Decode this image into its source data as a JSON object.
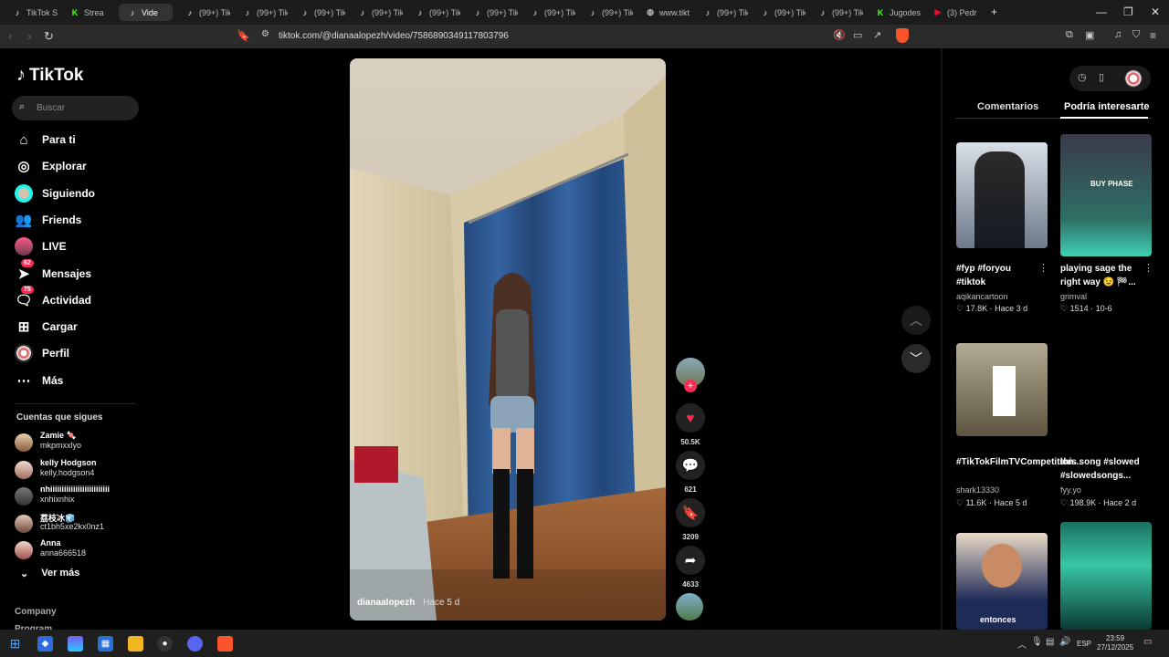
{
  "browser": {
    "tabs": [
      {
        "label": "TikTok S",
        "icon": "tiktok-icon"
      },
      {
        "label": "Strea",
        "icon": "kick-icon"
      },
      {
        "label": "Vide",
        "icon": "tiktok-icon",
        "active": true
      },
      {
        "label": "(99+) Tik",
        "icon": "tiktok-icon"
      },
      {
        "label": "(99+) Tik",
        "icon": "tiktok-icon"
      },
      {
        "label": "(99+) Tik",
        "icon": "tiktok-icon"
      },
      {
        "label": "(99+) Tik",
        "icon": "tiktok-icon"
      },
      {
        "label": "(99+) Tik",
        "icon": "tiktok-icon"
      },
      {
        "label": "(99+) Tik",
        "icon": "tiktok-icon"
      },
      {
        "label": "(99+) Tik",
        "icon": "tiktok-icon"
      },
      {
        "label": "(99+) Tik",
        "icon": "tiktok-icon"
      },
      {
        "label": "www.tikt",
        "icon": "globe-icon"
      },
      {
        "label": "(99+) Tik",
        "icon": "tiktok-icon"
      },
      {
        "label": "(99+) Tik",
        "icon": "tiktok-icon"
      },
      {
        "label": "(99+) Tik",
        "icon": "tiktok-icon"
      },
      {
        "label": "Jugodes",
        "icon": "kick-icon"
      },
      {
        "label": "(3) Pedr",
        "icon": "youtube-icon"
      }
    ],
    "new_tab": "+",
    "url": "tiktok.com/@dianaalopezh/video/7586890349117803796"
  },
  "tiktok": {
    "logo": "TikTok",
    "search_placeholder": "Buscar",
    "nav": [
      {
        "label": "Para ti",
        "icon": "home-icon"
      },
      {
        "label": "Explorar",
        "icon": "compass-icon"
      },
      {
        "label": "Siguiendo",
        "icon": "following-avatar-icon"
      },
      {
        "label": "Friends",
        "icon": "friends-icon"
      },
      {
        "label": "LIVE",
        "icon": "live-icon"
      },
      {
        "label": "Mensajes",
        "icon": "messages-icon",
        "badge": "62"
      },
      {
        "label": "Actividad",
        "icon": "activity-icon",
        "badge": "75"
      },
      {
        "label": "Cargar",
        "icon": "upload-icon"
      },
      {
        "label": "Perfil",
        "icon": "profile-icon"
      },
      {
        "label": "Más",
        "icon": "more-icon"
      }
    ],
    "following_title": "Cuentas que sigues",
    "following": [
      {
        "name": "Zamie 🍬",
        "handle": "mkpmxxlyo"
      },
      {
        "name": "kelly Hodgson",
        "handle": "kelly.hodgson4"
      },
      {
        "name": "nhiiiiiiiiiiiiiiiiiiiiiiiiii",
        "handle": "xnhixnhix"
      },
      {
        "name": "荔枝冰🧊",
        "handle": "ct1bh5xe2kx0nz1"
      },
      {
        "name": "Anna",
        "handle": "anna666518"
      }
    ],
    "see_more": "Ver más",
    "footer": [
      "Company",
      "Program"
    ]
  },
  "video": {
    "author": "dianaalopezh",
    "time": " · Hace 5 d",
    "likes": "50.5K",
    "comments": "621",
    "saves": "3209",
    "shares": "4633"
  },
  "right_panel": {
    "tabs": [
      "Comentarios",
      "Podría interesarte"
    ],
    "cards": [
      {
        "title": "#fyp #foryou #tiktok",
        "author": "aqikancartoon",
        "likes": "17.8K",
        "time": "Hace 3 d",
        "thumb_text": ""
      },
      {
        "title": "playing sage the right way 😉 🏁...",
        "author": "grimval",
        "likes": "1514",
        "time": "10-6",
        "thumb_text": "BUY PHASE"
      },
      {
        "title": "#TikTokFilmTVCompetition...",
        "author": "shark13330",
        "likes": "11.6K",
        "time": "Hace 5 d",
        "thumb_text": ""
      },
      {
        "title": "this song #slowed #slowedsongs...",
        "author": "fyy.yo",
        "likes": "198.9K",
        "time": "Hace 2 d",
        "thumb_text": ""
      },
      {
        "title": "",
        "author": "",
        "likes": "",
        "time": "",
        "thumb_text": "entonces"
      },
      {
        "title": "",
        "author": "",
        "likes": "",
        "time": "",
        "thumb_text": ""
      }
    ]
  },
  "taskbar": {
    "lang": "ESP",
    "time": "23:59",
    "date": "27/12/2025"
  },
  "colors": {
    "tiktok_red": "#fe2c55",
    "background": "#000000",
    "curtain_blue": "#2e5c96"
  }
}
